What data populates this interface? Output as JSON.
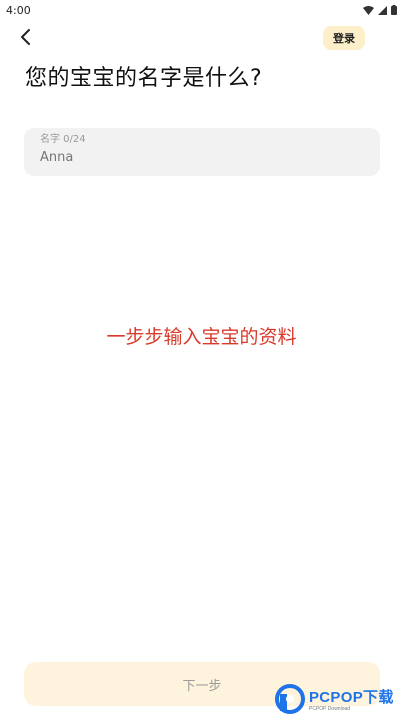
{
  "status_bar": {
    "time": "4:00",
    "icons": [
      "wifi-icon",
      "signal-icon",
      "battery-icon"
    ]
  },
  "header": {
    "back_icon": "chevron-left-icon",
    "login_label": "登录"
  },
  "main": {
    "question": "您的宝宝的名字是什么?",
    "name_field": {
      "label": "名字 0/24",
      "placeholder": "Anna",
      "value": ""
    },
    "promo": "一步步输入宝宝的资料"
  },
  "footer": {
    "next_label": "下一步"
  },
  "watermark": {
    "brand": "PCPOP下载",
    "sub": "PCPOP Download",
    "icon": "pcpop-logo-icon"
  },
  "colors": {
    "login_bg": "#FCEFC9",
    "input_bg": "#F2F2F2",
    "promo": "#D93A2B",
    "next_bg": "#FEF3DC",
    "brand": "#1E73E8"
  }
}
